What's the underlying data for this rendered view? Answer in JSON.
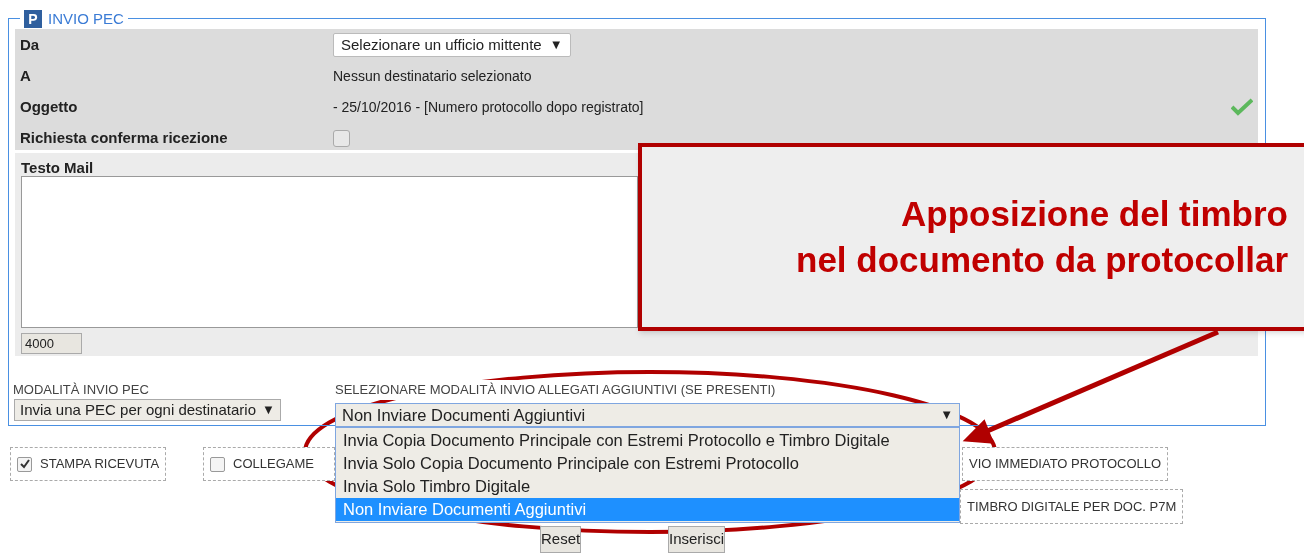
{
  "section": {
    "badge": "P",
    "title": "INVIO PEC"
  },
  "fields": [
    {
      "kind": "select",
      "label": "Da",
      "value": "Selezionare un ufficio mittente",
      "caret": "▼"
    },
    {
      "kind": "text",
      "label": "A",
      "value": "Nessun destinatario selezionato"
    },
    {
      "kind": "text",
      "label": "Oggetto",
      "value": "- 25/10/2016 - [Numero protocollo dopo registrato]",
      "valid": true
    },
    {
      "kind": "checkbox",
      "label": "Richiesta conferma ricezione",
      "checked": false
    }
  ],
  "mail": {
    "label": "Testo Mail",
    "counter": "4000"
  },
  "send_mode": {
    "label": "MODALITÀ INVIO PEC",
    "value": "Invia una PEC per ogni destinatario",
    "caret": "▼"
  },
  "attachments_mode": {
    "label": "SELEZIONARE MODALITÀ INVIO ALLEGATI AGGIUNTIVI (SE PRESENTI)",
    "value": "Non Inviare Documenti Aggiuntivi",
    "caret": "▼",
    "expanded": true,
    "options": [
      {
        "label": "Invia Copia Documento Principale con Estremi Protocollo e Timbro Digitale",
        "selected": false
      },
      {
        "label": "Invia Solo Copia Documento Principale con Estremi Protocollo",
        "selected": false
      },
      {
        "label": "Invia Solo Timbro Digitale",
        "selected": false
      },
      {
        "label": "Non Inviare Documenti Aggiuntivi",
        "selected": true
      }
    ]
  },
  "options_row_1": [
    {
      "kind": "checkbox",
      "label": "STAMPA RICEVUTA",
      "checked": true
    },
    {
      "kind": "checkbox",
      "label": "COLLEGAME",
      "checked": false
    },
    {
      "kind": "label",
      "label": "VIO IMMEDIATO PROTOCOLLO"
    }
  ],
  "options_row_2": [
    {
      "kind": "label",
      "label": "TIMBRO DIGITALE PER DOC. P7M"
    }
  ],
  "buttons": [
    "Reset",
    "Inserisci"
  ],
  "callout": {
    "lines": [
      "Apposizione del timbro",
      "nel documento da protocollar"
    ]
  }
}
